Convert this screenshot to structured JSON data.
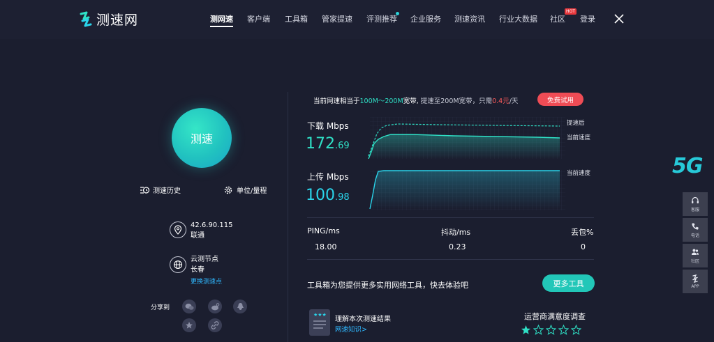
{
  "logo": {
    "text": "测速网"
  },
  "nav": [
    {
      "label": "测网速",
      "active": true
    },
    {
      "label": "客户端"
    },
    {
      "label": "工具箱"
    },
    {
      "label": "管家提速"
    },
    {
      "label": "评测推荐"
    },
    {
      "label": "企业服务"
    },
    {
      "label": "测速资讯"
    },
    {
      "label": "行业大数据"
    },
    {
      "label": "社区",
      "badge": "HOT"
    },
    {
      "label": "登录"
    }
  ],
  "left": {
    "speed_button": "测速",
    "history": "测速历史",
    "units": "单位/量程",
    "ip": "42.6.90.115",
    "isp": "联通",
    "node_title": "云测节点",
    "node_city": "长春",
    "change_node": "更换测速点",
    "share_label": "分享到"
  },
  "promo": {
    "p1": "当前网速相当于",
    "p2": "100M～200M",
    "p3": "宽带,",
    "p4": "提速至200M宽带，只需",
    "p5": "0.4元",
    "p6": "/天",
    "trial": "免费试用"
  },
  "download": {
    "label": "下载 Mbps",
    "int": "172",
    "dec": ".69",
    "note_boost": "提速后",
    "note_current": "当前速度"
  },
  "upload": {
    "label": "上传 Mbps",
    "int": "100",
    "dec": ".98",
    "note_current": "当前速度"
  },
  "stats": {
    "ping_label": "PING/ms",
    "ping": "18.00",
    "jitter_label": "抖动/ms",
    "jitter": "0.23",
    "loss_label": "丢包%",
    "loss": "0"
  },
  "tools": {
    "text": "工具箱为您提供更多实用网络工具，快去体验吧",
    "button": "更多工具"
  },
  "result": {
    "title": "理解本次测速结果",
    "link": "网速知识>"
  },
  "survey": {
    "title": "运营商满意度调查",
    "rating": 1,
    "max": 5
  },
  "side": {
    "badge": "5G",
    "items": [
      "客服",
      "电话",
      "社区",
      "APP"
    ]
  },
  "colors": {
    "accent": "#2fe0c6",
    "upload": "#2ad4ea",
    "red": "#ef4c55",
    "bg": "#1b1e2f"
  }
}
